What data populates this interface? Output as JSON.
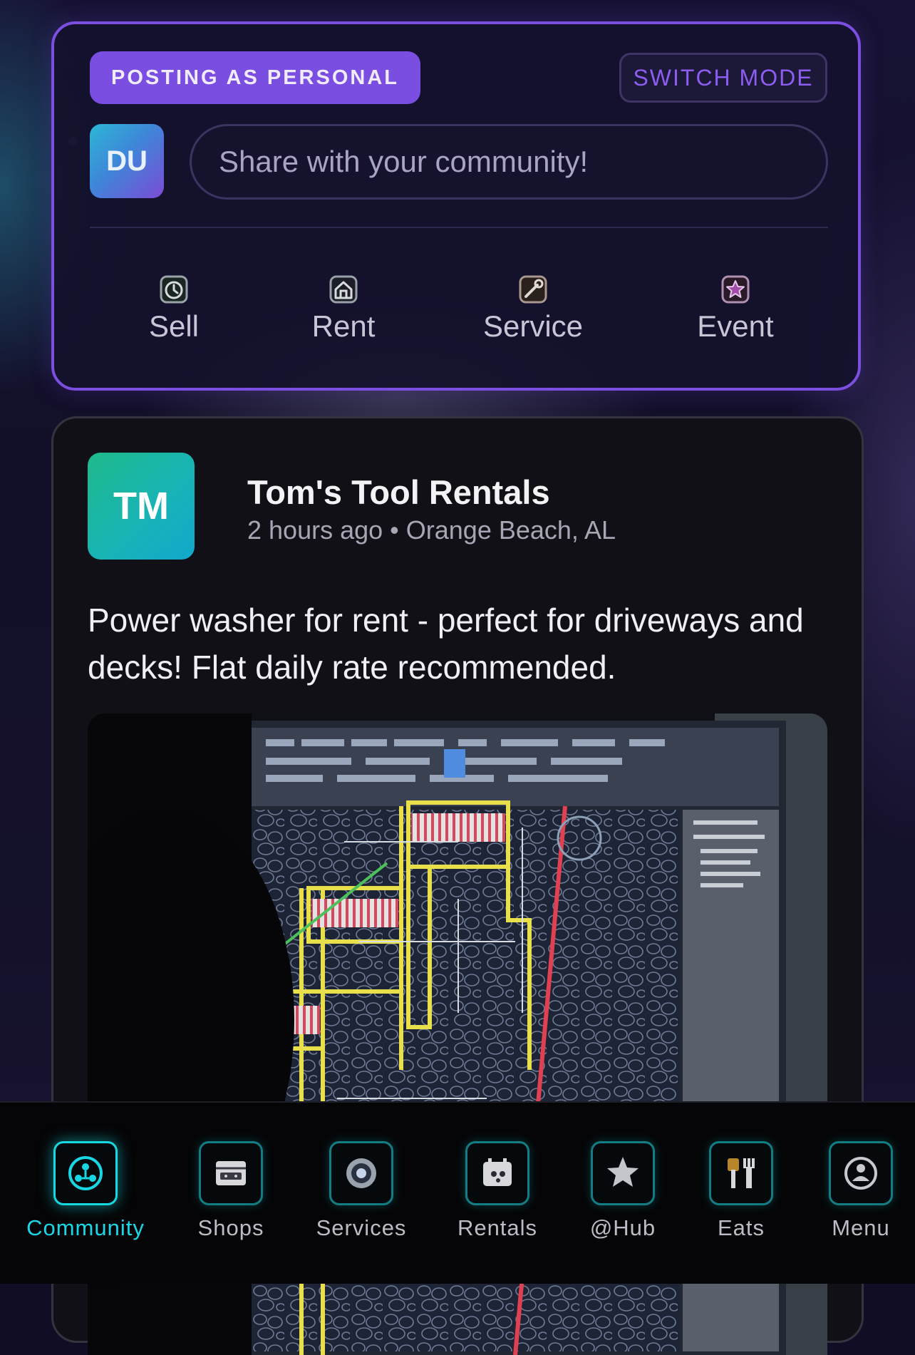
{
  "composer": {
    "mode_label": "POSTING AS PERSONAL",
    "switch_label": "SWITCH MODE",
    "avatar_initials": "DU",
    "placeholder": "Share with your community!",
    "actions": [
      {
        "label": "Sell",
        "icon": "clock-icon"
      },
      {
        "label": "Rent",
        "icon": "home-icon"
      },
      {
        "label": "Service",
        "icon": "tools-icon"
      },
      {
        "label": "Event",
        "icon": "star-icon"
      }
    ]
  },
  "post": {
    "avatar_initials": "TM",
    "author": "Tom's Tool Rentals",
    "time": "2 hours ago",
    "separator": "•",
    "location": "Orange Beach, AL",
    "text": "Power washer for rent - perfect for driveways and decks! Flat daily rate recommended.",
    "image_description_icon": "cad-drawing-photo"
  },
  "bottom_nav": {
    "items": [
      {
        "label": "Community",
        "icon": "community-icon",
        "active": true
      },
      {
        "label": "Shops",
        "icon": "shop-icon",
        "active": false
      },
      {
        "label": "Services",
        "icon": "services-icon",
        "active": false
      },
      {
        "label": "Rentals",
        "icon": "rentals-icon",
        "active": false
      },
      {
        "label": "@Hub",
        "icon": "star-icon",
        "active": false
      },
      {
        "label": "Eats",
        "icon": "utensils-icon",
        "active": false
      },
      {
        "label": "Menu",
        "icon": "menu-icon",
        "active": false
      }
    ]
  },
  "colors": {
    "accent_purple": "#7a4ee0",
    "accent_cyan": "#1ad7e6",
    "tm_avatar": "#17b3b8"
  }
}
